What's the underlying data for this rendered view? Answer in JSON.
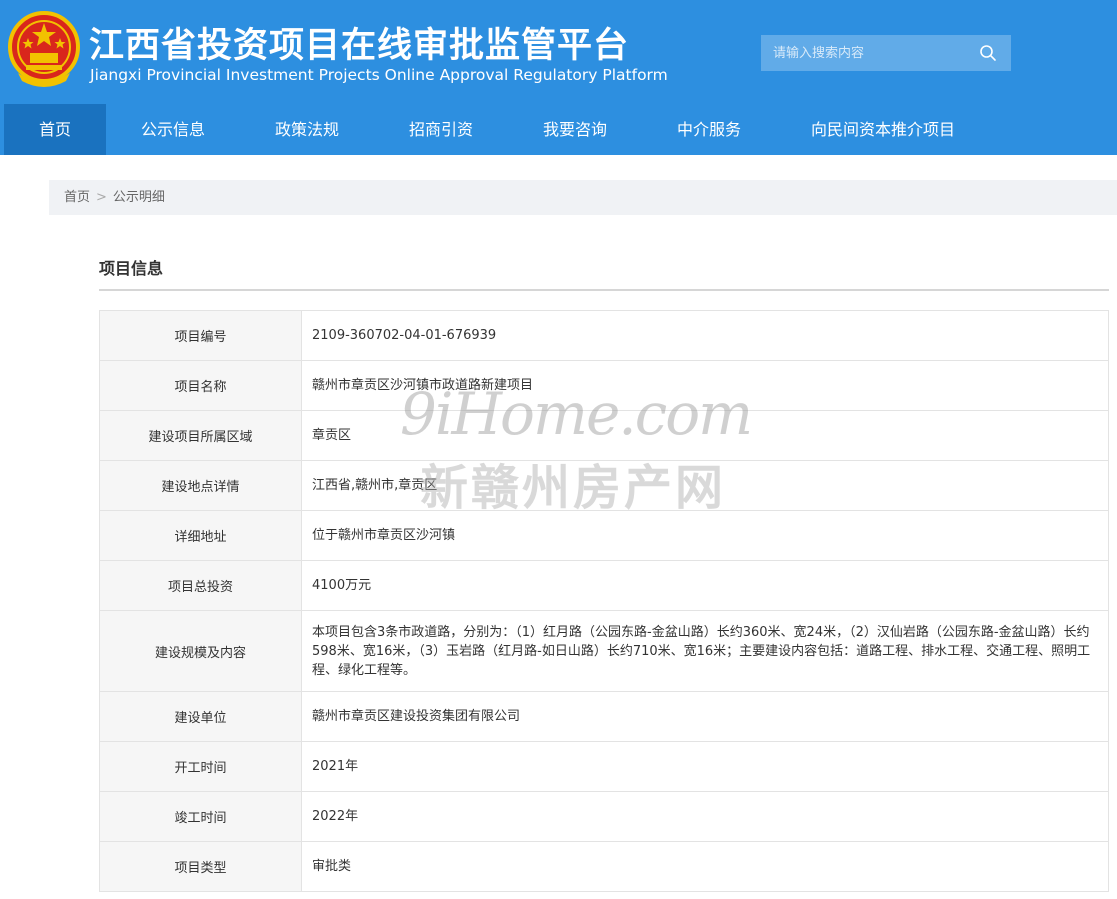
{
  "header": {
    "title": "江西省投资项目在线审批监管平台",
    "subtitle": "Jiangxi Provincial Investment Projects Online Approval Regulatory Platform",
    "emblem_icon": "national-emblem-icon",
    "search": {
      "placeholder": "请输入搜索内容",
      "value": "",
      "icon": "search-icon"
    },
    "bg_color": "#2d8fe0",
    "active_color": "#1a72bf"
  },
  "nav": {
    "items": [
      {
        "label": "首页",
        "active": true
      },
      {
        "label": "公示信息",
        "active": false
      },
      {
        "label": "政策法规",
        "active": false
      },
      {
        "label": "招商引资",
        "active": false
      },
      {
        "label": "我要咨询",
        "active": false
      },
      {
        "label": "中介服务",
        "active": false
      },
      {
        "label": "向民间资本推介项目",
        "active": false
      }
    ]
  },
  "breadcrumb": {
    "home": "首页",
    "separator": ">",
    "current": "公示明细"
  },
  "section": {
    "title": "项目信息"
  },
  "project": {
    "rows": [
      {
        "label": "项目编号",
        "value": "2109-360702-04-01-676939"
      },
      {
        "label": "项目名称",
        "value": "赣州市章贡区沙河镇市政道路新建项目"
      },
      {
        "label": "建设项目所属区域",
        "value": "章贡区"
      },
      {
        "label": "建设地点详情",
        "value": "江西省,赣州市,章贡区"
      },
      {
        "label": "详细地址",
        "value": "位于赣州市章贡区沙河镇"
      },
      {
        "label": "项目总投资",
        "value": "4100万元"
      },
      {
        "label": "建设规模及内容",
        "value": "本项目包含3条市政道路，分别为：（1）红月路（公园东路-金盆山路）长约360米、宽24米，（2）汉仙岩路（公园东路-金盆山路）长约598米、宽16米，（3）玉岩路（红月路-如日山路）长约710米、宽16米；主要建设内容包括：道路工程、排水工程、交通工程、照明工程、绿化工程等。"
      },
      {
        "label": "建设单位",
        "value": "赣州市章贡区建设投资集团有限公司"
      },
      {
        "label": "开工时间",
        "value": "2021年"
      },
      {
        "label": "竣工时间",
        "value": "2022年"
      },
      {
        "label": "项目类型",
        "value": "审批类"
      }
    ]
  },
  "watermark": {
    "en": "9iHome.com",
    "cn": "新赣州房产网"
  }
}
